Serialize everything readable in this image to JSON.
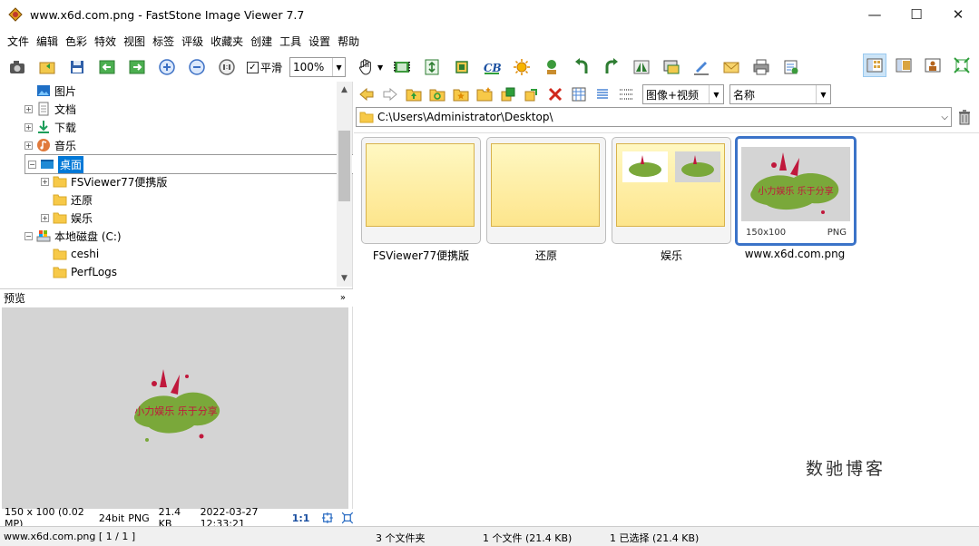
{
  "window": {
    "title": "www.x6d.com.png  -  FastStone Image Viewer 7.7",
    "minimize": "—",
    "maximize": "☐",
    "close": "✕"
  },
  "menu": [
    "文件",
    "编辑",
    "色彩",
    "特效",
    "视图",
    "标签",
    "评级",
    "收藏夹",
    "创建",
    "工具",
    "设置",
    "帮助"
  ],
  "toolbar": {
    "smooth_label": "平滑",
    "smooth_checked": "✓",
    "zoom_value": "100%"
  },
  "tree": {
    "items": [
      {
        "label": "图片",
        "icon": "pictures-icon"
      },
      {
        "label": "文档",
        "icon": "documents-icon"
      },
      {
        "label": "下载",
        "icon": "download-icon"
      },
      {
        "label": "音乐",
        "icon": "music-icon"
      },
      {
        "label": "桌面",
        "icon": "desktop-icon"
      },
      {
        "label": "FSViewer77便携版",
        "icon": "folder-icon"
      },
      {
        "label": "还原",
        "icon": "folder-icon"
      },
      {
        "label": "娱乐",
        "icon": "folder-icon"
      },
      {
        "label": "本地磁盘 (C:)",
        "icon": "drive-icon"
      },
      {
        "label": "ceshi",
        "icon": "folder-icon"
      },
      {
        "label": "PerfLogs",
        "icon": "folder-icon"
      }
    ]
  },
  "preview": {
    "header": "预览",
    "logo_text": "小力娱乐  乐于分享",
    "info": {
      "dims": "150 x 100 (0.02 MP)",
      "bits": "24bit",
      "format": "PNG",
      "size": "21.4 KB",
      "date": "2022-03-27 12:33:21",
      "ratio": "1:1"
    }
  },
  "browser": {
    "filter": "图像+视频",
    "sort": "名称",
    "path": "C:\\Users\\Administrator\\Desktop\\",
    "items": [
      {
        "name": "FSViewer77便携版",
        "type": "folder"
      },
      {
        "name": "还原",
        "type": "folder"
      },
      {
        "name": "娱乐",
        "type": "folder"
      },
      {
        "name": "www.x6d.com.png",
        "type": "image",
        "dims": "150x100",
        "format": "PNG"
      }
    ],
    "watermark": "数驰博客"
  },
  "status": {
    "file": "www.x6d.com.png [ 1 / 1 ]",
    "folders": "3 个文件夹",
    "files": "1 个文件 (21.4 KB)",
    "selected": "1 已选择 (21.4 KB)"
  },
  "colors": {
    "selection": "#0078d7",
    "thumb_border": "#3b73c8",
    "folder_fill": "#fde58c"
  }
}
